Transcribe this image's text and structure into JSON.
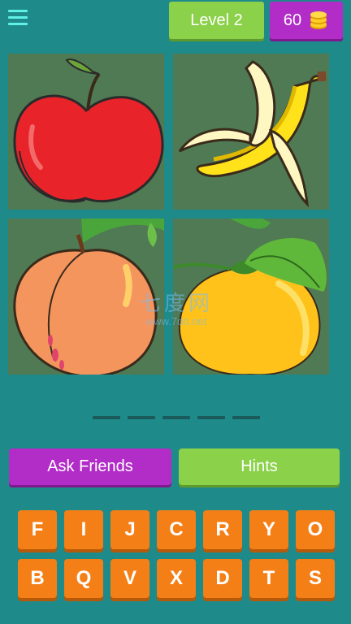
{
  "header": {
    "level_label": "Level 2",
    "coins": "60",
    "menu_icon": "hamburger-menu-icon",
    "coin_icon": "coin-stack-icon"
  },
  "puzzle": {
    "images": [
      "apple",
      "banana",
      "peach",
      "orange"
    ]
  },
  "watermark": {
    "text": "七度网",
    "url": "www.7do.net"
  },
  "answer": {
    "slots": [
      "",
      "",
      "",
      "",
      ""
    ]
  },
  "actions": {
    "ask_friends": "Ask Friends",
    "hints": "Hints"
  },
  "keyboard": {
    "row1": [
      "F",
      "I",
      "J",
      "C",
      "R",
      "Y",
      "O"
    ],
    "row2": [
      "B",
      "Q",
      "V",
      "X",
      "D",
      "T",
      "S"
    ]
  },
  "colors": {
    "background": "#1e8a8a",
    "green_button": "#8bd14a",
    "purple_button": "#b22cc7",
    "key_orange": "#f57f17",
    "tile_bg": "#4f7a54"
  }
}
